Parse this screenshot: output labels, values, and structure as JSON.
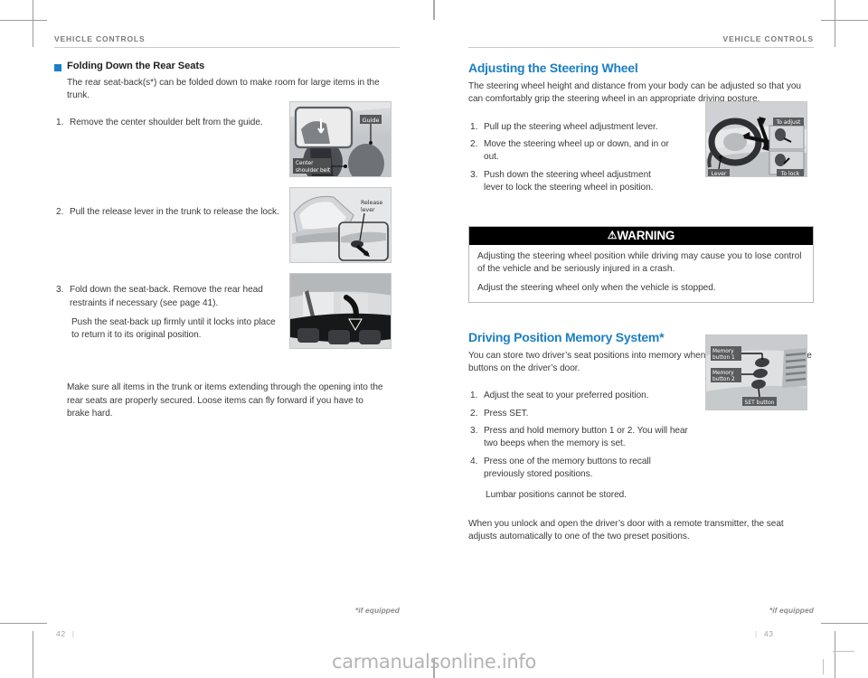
{
  "document": {
    "running_head_left": "VEHICLE CONTROLS",
    "running_head_right": "VEHICLE CONTROLS",
    "watermark": "carmanualsonline.info"
  },
  "left_page": {
    "folio": "42",
    "folio_bar": "|",
    "footnote": "*if equipped",
    "section": {
      "heading": "Folding Down the Rear Seats",
      "intro": "The rear seat-back(s*) can be folded down to make room for large items in the trunk.",
      "steps": [
        {
          "num": "1.",
          "text": "Remove the center shoulder belt from the guide.",
          "figure": {
            "name": "center-shoulder-belt-figure",
            "labels": [
              "Guide",
              "Center shoulder belt"
            ]
          }
        },
        {
          "num": "2.",
          "text": "Pull the release lever in the trunk to release the lock.",
          "figure": {
            "name": "trunk-release-lever-figure",
            "labels": [
              "Release lever"
            ]
          }
        },
        {
          "num": "3.",
          "text": "Fold down the seat-back. Remove the rear head restraints if necessary (see page 41).",
          "subtext": "Push the seat-back up firmly until it locks into place to return it to its original position.",
          "figure": {
            "name": "fold-down-seat-back-figure",
            "labels": []
          }
        }
      ],
      "closing": "Make sure all items in the trunk or items extending through the opening into the rear seats are properly secured. Loose items can fly forward if you have to brake hard."
    }
  },
  "right_page": {
    "folio": "43",
    "folio_bar": "|",
    "footnote": "*if equipped",
    "steering": {
      "heading": "Adjusting the Steering Wheel",
      "intro": "The steering wheel height and distance from your body can be adjusted so that you can comfortably grip the steering wheel in an appropriate driving posture.",
      "steps": [
        {
          "num": "1.",
          "text": "Pull up the steering wheel adjustment lever."
        },
        {
          "num": "2.",
          "text": "Move the steering wheel up or down, and in or out."
        },
        {
          "num": "3.",
          "text": "Push down the steering wheel adjustment lever to lock the steering wheel in position."
        }
      ],
      "figure": {
        "name": "steering-wheel-adjust-figure",
        "labels": [
          "To adjust",
          "To lock",
          "Lever"
        ]
      }
    },
    "warning": {
      "title": "WARNING",
      "triangle_glyph": "⚠",
      "lines": [
        "Adjusting the steering wheel position while driving may cause you to lose control of the vehicle and be seriously injured in a crash.",
        "Adjust the steering wheel only when the vehicle is stopped."
      ]
    },
    "memory": {
      "heading": "Driving Position Memory System*",
      "intro": "You can store two driver’s seat positions into memory when the vehicle is on using the buttons on the driver’s door.",
      "steps": [
        {
          "num": "1.",
          "text": "Adjust the seat to your preferred position."
        },
        {
          "num": "2.",
          "text": "Press SET."
        },
        {
          "num": "3.",
          "text": "Press and hold memory button 1 or 2. You will hear two beeps when the memory is set."
        },
        {
          "num": "4.",
          "text": "Press one of the memory buttons to recall previously stored positions.",
          "subtext": "Lumbar positions cannot be stored."
        }
      ],
      "figure": {
        "name": "memory-buttons-figure",
        "labels": [
          "Memory button 1",
          "Memory button 2",
          "SET button"
        ]
      },
      "closing": "When you unlock and open the driver’s door with a remote transmitter, the seat adjusts automatically to one of the two preset positions."
    }
  },
  "colors": {
    "accent_blue": "#1b7fc4",
    "body_text": "#3a3a3a",
    "running_head": "#7a7a7a",
    "rule": "#c9c9c9",
    "warning_bar": "#000000"
  }
}
